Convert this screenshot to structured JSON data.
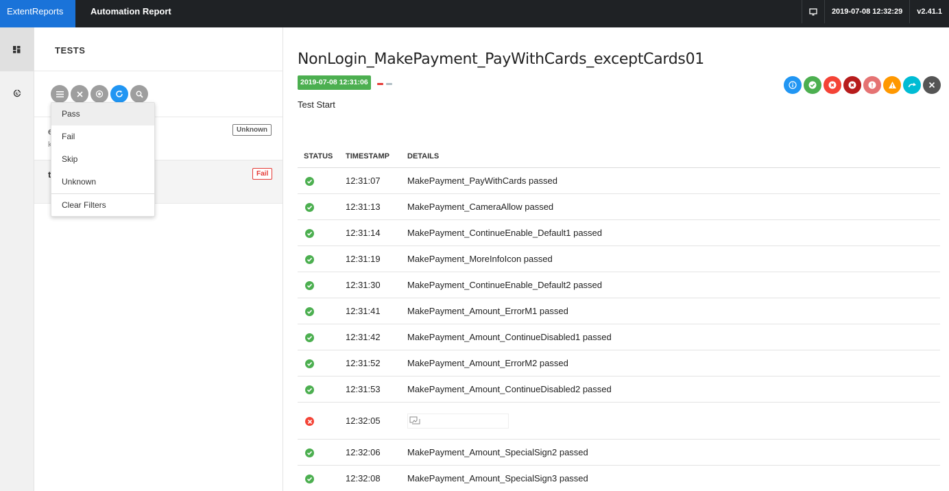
{
  "topbar": {
    "brand": "ExtentReports",
    "title": "Automation Report",
    "datetime": "2019-07-08 12:32:29",
    "version": "v2.41.1",
    "monitor_icon": "monitor-icon"
  },
  "nav": {
    "items": [
      {
        "icon": "dashboard-icon",
        "active": true
      },
      {
        "icon": "analysis-icon",
        "active": false
      }
    ]
  },
  "test_panel": {
    "title": "TESTS",
    "filter_icons": [
      "menu-icon",
      "close-icon",
      "tag-icon",
      "refresh-icon",
      "search-icon"
    ],
    "items": [
      {
        "name": "ents/Maven_P",
        "sub": "k",
        "status": "Unknown"
      },
      {
        "name": "t_PayWithCar",
        "sub": "",
        "status": "Fail"
      }
    ]
  },
  "dropdown": {
    "items": [
      "Pass",
      "Fail",
      "Skip",
      "Unknown"
    ],
    "clear": "Clear Filters"
  },
  "main": {
    "title": "NonLogin_MakePayment_PayWithCards_exceptCards01",
    "started": "2019-07-08 12:31:06",
    "description": "Test Start",
    "status_filter_colors": [
      "#2196f3",
      "#4caf50",
      "#f44336",
      "#b71c1c",
      "#e57373",
      "#ff9800",
      "#00bcd4",
      "#555555"
    ],
    "table": {
      "headers": {
        "status": "STATUS",
        "timestamp": "TIMESTAMP",
        "details": "DETAILS"
      },
      "rows": [
        {
          "status": "pass",
          "time": "12:31:07",
          "details": "MakePayment_PayWithCards passed"
        },
        {
          "status": "pass",
          "time": "12:31:13",
          "details": "MakePayment_CameraAllow passed"
        },
        {
          "status": "pass",
          "time": "12:31:14",
          "details": "MakePayment_ContinueEnable_Default1 passed"
        },
        {
          "status": "pass",
          "time": "12:31:19",
          "details": "MakePayment_MoreInfoIcon passed"
        },
        {
          "status": "pass",
          "time": "12:31:30",
          "details": "MakePayment_ContinueEnable_Default2 passed"
        },
        {
          "status": "pass",
          "time": "12:31:41",
          "details": "MakePayment_Amount_ErrorM1 passed"
        },
        {
          "status": "pass",
          "time": "12:31:42",
          "details": "MakePayment_Amount_ContinueDisabled1 passed"
        },
        {
          "status": "pass",
          "time": "12:31:52",
          "details": "MakePayment_Amount_ErrorM2 passed"
        },
        {
          "status": "pass",
          "time": "12:31:53",
          "details": "MakePayment_Amount_ContinueDisabled2 passed"
        },
        {
          "status": "fail",
          "time": "12:32:05",
          "details": ""
        },
        {
          "status": "pass",
          "time": "12:32:06",
          "details": "MakePayment_Amount_SpecialSign2 passed"
        },
        {
          "status": "pass",
          "time": "12:32:08",
          "details": "MakePayment_Amount_SpecialSign3 passed"
        }
      ]
    }
  },
  "colors": {
    "brand": "#1a73d9",
    "topbar": "#1f2225",
    "pass": "#4caf50",
    "fail": "#f44336"
  }
}
